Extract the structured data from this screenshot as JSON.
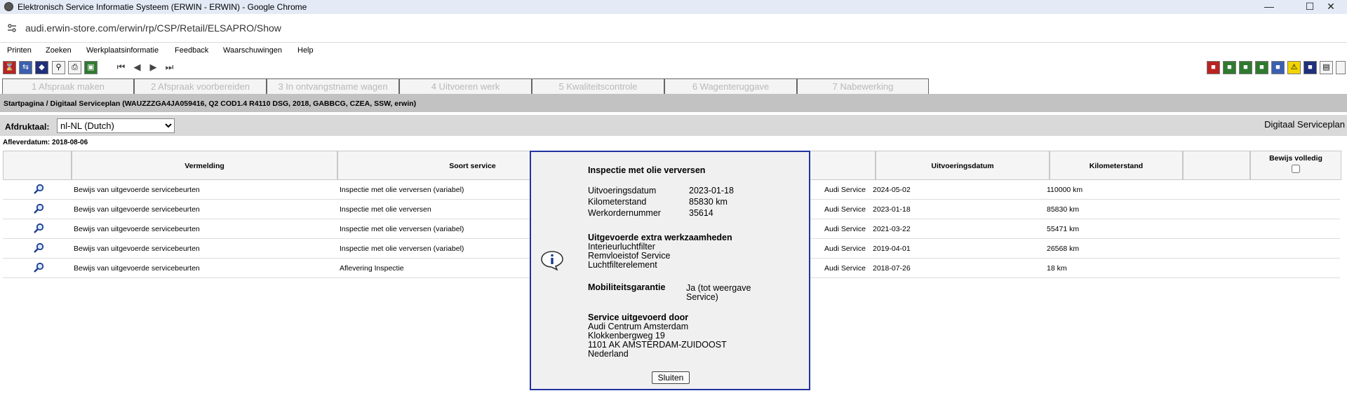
{
  "window": {
    "title": "Elektronisch Service Informatie Systeem (ERWIN - ERWIN) - Google Chrome"
  },
  "browser": {
    "url": "audi.erwin-store.com/erwin/rp/CSP/Retail/ELSAPRO/Show"
  },
  "menu": [
    "Printen",
    "Zoeken",
    "Werkplaatsinformatie",
    "Feedback",
    "Waarschuwingen",
    "Help"
  ],
  "tabs": [
    "1 Afspraak maken",
    "2 Afspraak voorbereiden",
    "3 In ontvangstname wagen",
    "4 Uitvoeren werk",
    "5 Kwaliteitscontrole",
    "6 Wagenteruggave",
    "7 Nabewerking"
  ],
  "breadcrumb": "Startpagina / Digitaal Serviceplan (WAUZZZGA4JA059416, Q2 COD1.4 R4110 DSG, 2018, GABBCG, CZEA, SSW, erwin)",
  "print_language": {
    "label": "Afdruktaal:",
    "value": "nl-NL (Dutch)"
  },
  "page_title": "Digitaal Serviceplan",
  "delivery_date": "Afleverdatum: 2018-08-06",
  "table": {
    "headers": {
      "vermelding": "Vermelding",
      "soort": "Soort service",
      "datum": "Uitvoeringsdatum",
      "km": "Kilometerstand",
      "bewijs": "Bewijs volledig"
    },
    "rows": [
      {
        "vermelding": "Bewijs van uitgevoerde servicebeurten",
        "soort": "Inspectie met olie verversen (variabel)",
        "door": "Audi Service",
        "datum": "2024-05-02",
        "km": "110000 km"
      },
      {
        "vermelding": "Bewijs van uitgevoerde servicebeurten",
        "soort": "Inspectie met olie verversen",
        "door": "Audi Service",
        "datum": "2023-01-18",
        "km": "85830 km"
      },
      {
        "vermelding": "Bewijs van uitgevoerde servicebeurten",
        "soort": "Inspectie met olie verversen (variabel)",
        "door": "Audi Service",
        "datum": "2021-03-22",
        "km": "55471 km"
      },
      {
        "vermelding": "Bewijs van uitgevoerde servicebeurten",
        "soort": "Inspectie met olie verversen (variabel)",
        "door": "Audi Service",
        "datum": "2019-04-01",
        "km": "26568 km"
      },
      {
        "vermelding": "Bewijs van uitgevoerde servicebeurten",
        "soort": "Aflevering Inspectie",
        "door": "Audi Service",
        "datum": "2018-07-26",
        "km": "18 km"
      }
    ]
  },
  "popup": {
    "title": "Inspectie met olie verversen",
    "fields": [
      {
        "label": "Uitvoeringsdatum",
        "value": "2023-01-18"
      },
      {
        "label": "Kilometerstand",
        "value": "85830 km"
      },
      {
        "label": "Werkordernummer",
        "value": "35614"
      }
    ],
    "extra_title": "Uitgevoerde extra werkzaamheden",
    "extra_items": [
      "Interieurluchtfilter",
      "Remvloeistof Service",
      "Luchtfilterelement"
    ],
    "mobility_label": "Mobiliteitsgarantie",
    "mobility_value_1": "Ja (tot weergave",
    "mobility_value_2": "Service)",
    "performer_title": "Service uitgevoerd door",
    "performer_lines": [
      "Audi Centrum Amsterdam",
      "Klokkenbergweg 19",
      "1101 AK AMSTERDAM-ZUIDOOST",
      "Nederland"
    ],
    "close_label": "Sluiten"
  }
}
